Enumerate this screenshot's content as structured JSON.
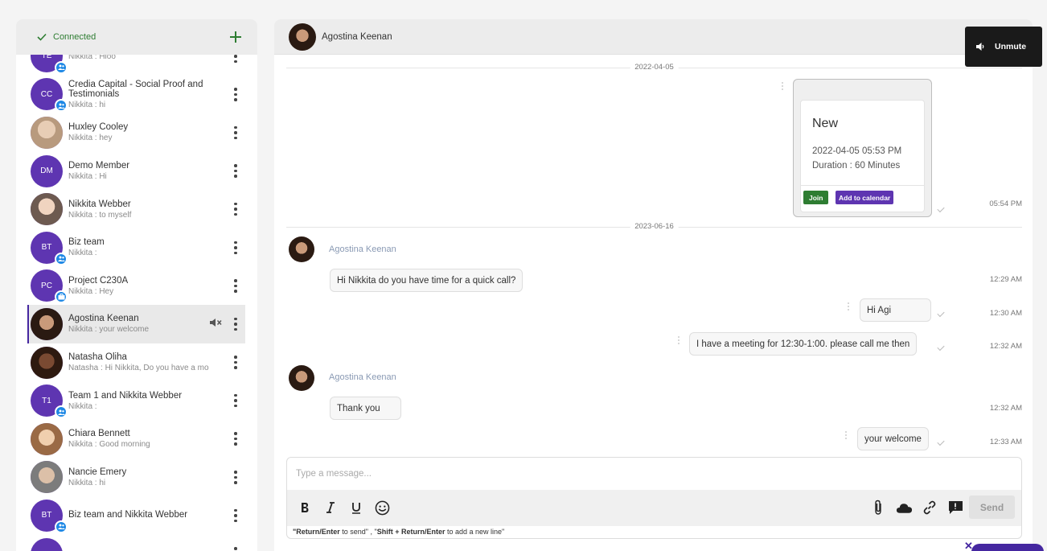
{
  "sidebar": {
    "status": "Connected",
    "contacts": [
      {
        "initials": "TE",
        "name": "",
        "last": "Nikkita : Hloo",
        "badge": "group"
      },
      {
        "initials": "CC",
        "name": "Credia Capital - Social Proof and Testimonials",
        "last": "Nikkita : hi",
        "badge": "group"
      },
      {
        "initials": "",
        "name": "Huxley Cooley",
        "last": "Nikkita : hey",
        "photo": "#b89a7e"
      },
      {
        "initials": "DM",
        "name": "Demo Member",
        "last": "Nikkita : Hi"
      },
      {
        "initials": "",
        "name": "Nikkita Webber",
        "last": "Nikkita : to myself",
        "photo": "#8d6e63"
      },
      {
        "initials": "BT",
        "name": "Biz team",
        "last": "Nikkita : ",
        "badge": "group"
      },
      {
        "initials": "PC",
        "name": "Project C230A",
        "last": "Nikkita : Hey",
        "badge": "project"
      },
      {
        "initials": "",
        "name": "Agostina Keenan",
        "last": "Nikkita : your welcome",
        "photo": "#3e2a20",
        "active": true
      },
      {
        "initials": "",
        "name": "Natasha Oliha",
        "last": "Natasha : Hi Nikkita, Do you have a mo",
        "photo": "#4a2c20"
      },
      {
        "initials": "T1",
        "name": "Team 1 and Nikkita Webber",
        "last": "Nikkita : ",
        "badge": "group"
      },
      {
        "initials": "",
        "name": "Chiara Bennett",
        "last": "Nikkita : Good morning",
        "photo": "#a07a5c"
      },
      {
        "initials": "",
        "name": "Nancie Emery",
        "last": "Nikkita : hi",
        "photo": "#8a8a8a"
      },
      {
        "initials": "BT",
        "name": "Biz team and Nikkita Webber",
        "last": "",
        "badge": "group"
      }
    ]
  },
  "chat": {
    "title": "Agostina Keenan",
    "date1": "2022-04-05",
    "date2": "2023-06-16",
    "meeting": {
      "title": "New",
      "datetime": "2022-04-05 05:53 PM",
      "duration": "Duration : 60 Minutes",
      "join": "Join",
      "add_calendar": "Add to calendar",
      "time": "05:54 PM"
    },
    "sender": "Agostina Keenan",
    "messages": [
      {
        "text": "Hi Nikkita do you have time for a quick call?",
        "time": "12:29 AM"
      },
      {
        "text": "Hi Agi",
        "time": "12:30 AM"
      },
      {
        "text": "I have a meeting for 12:30-1:00. please call me then",
        "time": "12:32 AM"
      },
      {
        "text": "Thank you",
        "time": "12:32 AM"
      },
      {
        "text": "your welcome",
        "time": "12:33 AM"
      }
    ]
  },
  "composer": {
    "placeholder": "Type a message...",
    "send": "Send",
    "hint_key1": "\"Return/Enter",
    "hint_text1": " to send\" , \"",
    "hint_key2": "Shift + Return/Enter",
    "hint_text2": " to add a new line\""
  },
  "popup": {
    "unmute": "Unmute"
  },
  "colors": {
    "accent": "#5e35b1",
    "online": "#2e7d32",
    "join": "#2e7d32"
  }
}
